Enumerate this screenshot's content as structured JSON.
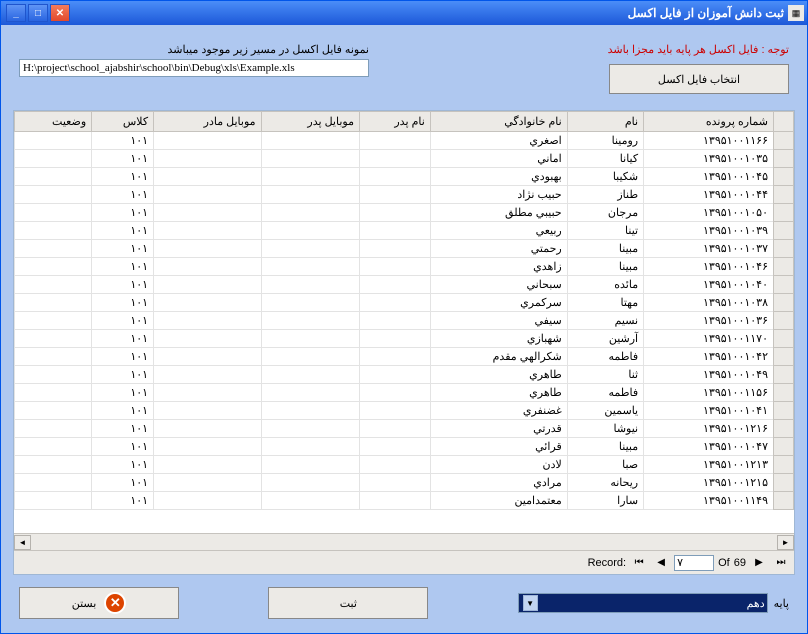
{
  "window": {
    "title": "ثبت دانش آموزان از فایل اکسل"
  },
  "notice": "توجه : فایل اکسل هر پایه باید مجزا باشد",
  "selectFileBtn": "انتخاب فایل اکسل",
  "pathLabel": "نمونه فایل اکسل در مسیر زیر موجود میباشد",
  "pathValue": "H:\\project\\school_ajabshir\\school\\bin\\Debug\\xls\\Example.xls",
  "columns": [
    "شماره پرونده",
    "نام",
    "نام خانوادگي",
    "نام پدر",
    "موبایل پدر",
    "موبایل مادر",
    "کلاس",
    "وضعیت"
  ],
  "rows": [
    {
      "id": "۱۳۹۵۱۰۰۱۱۶۶",
      "name": "رومینا",
      "family": "اصغري",
      "cls": "۱۰۱"
    },
    {
      "id": "۱۳۹۵۱۰۰۱۰۳۵",
      "name": "کیانا",
      "family": "اماني",
      "cls": "۱۰۱"
    },
    {
      "id": "۱۳۹۵۱۰۰۱۰۴۵",
      "name": "شکیبا",
      "family": "بهبودي",
      "cls": "۱۰۱"
    },
    {
      "id": "۱۳۹۵۱۰۰۱۰۴۴",
      "name": "طناز",
      "family": "حبيب نژاد",
      "cls": "۱۰۱"
    },
    {
      "id": "۱۳۹۵۱۰۰۱۰۵۰",
      "name": "مرجان",
      "family": "حبيبي مطلق",
      "cls": "۱۰۱"
    },
    {
      "id": "۱۳۹۵۱۰۰۱۰۳۹",
      "name": "تینا",
      "family": "ربيعي",
      "cls": "۱۰۱"
    },
    {
      "id": "۱۳۹۵۱۰۰۱۰۳۷",
      "name": "مبینا",
      "family": "رحمتي",
      "cls": "۱۰۱"
    },
    {
      "id": "۱۳۹۵۱۰۰۱۰۴۶",
      "name": "مبینا",
      "family": "زاهدي",
      "cls": "۱۰۱"
    },
    {
      "id": "۱۳۹۵۱۰۰۱۰۴۰",
      "name": "مائده",
      "family": "سبحاني",
      "cls": "۱۰۱"
    },
    {
      "id": "۱۳۹۵۱۰۰۱۰۳۸",
      "name": "مهتا",
      "family": "سرکمري",
      "cls": "۱۰۱"
    },
    {
      "id": "۱۳۹۵۱۰۰۱۰۳۶",
      "name": "نسیم",
      "family": "سيفي",
      "cls": "۱۰۱"
    },
    {
      "id": "۱۳۹۵۱۰۰۱۱۷۰",
      "name": "آرشین",
      "family": "شهبازي",
      "cls": "۱۰۱"
    },
    {
      "id": "۱۳۹۵۱۰۰۱۰۴۲",
      "name": "فاطمه",
      "family": "شکرالهي مقدم",
      "cls": "۱۰۱"
    },
    {
      "id": "۱۳۹۵۱۰۰۱۰۴۹",
      "name": "ثنا",
      "family": "طاهري",
      "cls": "۱۰۱"
    },
    {
      "id": "۱۳۹۵۱۰۰۱۱۵۶",
      "name": "فاطمه",
      "family": "طاهري",
      "cls": "۱۰۱"
    },
    {
      "id": "۱۳۹۵۱۰۰۱۰۴۱",
      "name": "یاسمین",
      "family": "غضنفري",
      "cls": "۱۰۱"
    },
    {
      "id": "۱۳۹۵۱۰۰۱۲۱۶",
      "name": "نیوشا",
      "family": "قدرتي",
      "cls": "۱۰۱"
    },
    {
      "id": "۱۳۹۵۱۰۰۱۰۴۷",
      "name": "مبینا",
      "family": "قرائي",
      "cls": "۱۰۱"
    },
    {
      "id": "۱۳۹۵۱۰۰۱۲۱۳",
      "name": "صبا",
      "family": "لادن",
      "cls": "۱۰۱"
    },
    {
      "id": "۱۳۹۵۱۰۰۱۲۱۵",
      "name": "ریحانه",
      "family": "مرادي",
      "cls": "۱۰۱"
    },
    {
      "id": "۱۳۹۵۱۰۰۱۱۴۹",
      "name": "سارا",
      "family": "معتمدامين",
      "cls": "۱۰۱"
    }
  ],
  "navigator": {
    "recordLabel": "Record:",
    "of": "Of",
    "total": "69",
    "current": "۷"
  },
  "grade": {
    "label": "پایه",
    "selected": "دهم"
  },
  "registerBtn": "ثبت",
  "closeBtn": "بستن"
}
